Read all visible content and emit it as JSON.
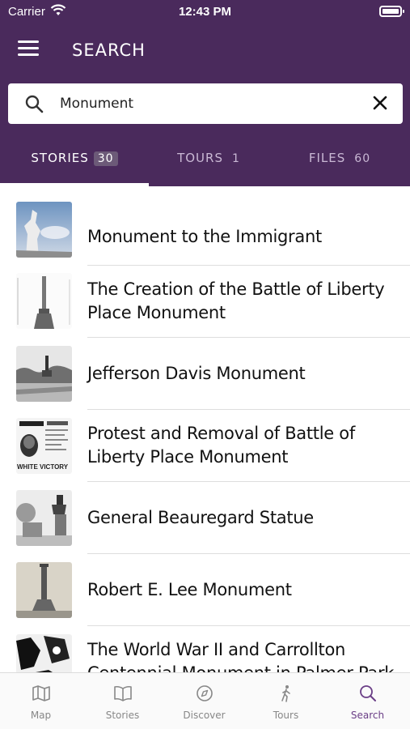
{
  "status_bar": {
    "carrier": "Carrier",
    "time": "12:43 PM"
  },
  "header": {
    "title": "SEARCH",
    "menu_icon": "hamburger-menu-icon"
  },
  "search": {
    "value": "Monument",
    "placeholder": ""
  },
  "tabs": [
    {
      "label": "STORIES",
      "count": "30",
      "active": true
    },
    {
      "label": "TOURS",
      "count": "1",
      "active": false
    },
    {
      "label": "FILES",
      "count": "60",
      "active": false
    }
  ],
  "results": [
    {
      "title": "Monument to the Immigrant"
    },
    {
      "title": "The Creation of the Battle of Liberty Place Monument"
    },
    {
      "title": "Jefferson Davis Monument"
    },
    {
      "title": "Protest and Removal of Battle of Liberty Place Monument",
      "thumb_caption": "WHITE VICTORY"
    },
    {
      "title": "General Beauregard Statue"
    },
    {
      "title": "Robert E. Lee Monument"
    },
    {
      "title": "The World War II and Carrollton Centennial Monument in Palmer Park"
    }
  ],
  "tabbar": [
    {
      "label": "Map",
      "icon": "map-icon",
      "active": false
    },
    {
      "label": "Stories",
      "icon": "book-icon",
      "active": false
    },
    {
      "label": "Discover",
      "icon": "compass-icon",
      "active": false
    },
    {
      "label": "Tours",
      "icon": "walking-person-icon",
      "active": false
    },
    {
      "label": "Search",
      "icon": "search-icon",
      "active": true
    }
  ],
  "colors": {
    "brand": "#4a2a5c",
    "active_tab": "#6a3e86"
  }
}
